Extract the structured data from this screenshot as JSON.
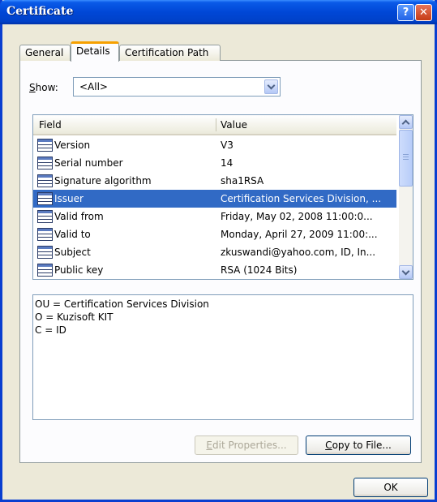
{
  "window": {
    "title": "Certificate",
    "help_label": "?",
    "close_label": "✕"
  },
  "tabs": [
    {
      "label": "General",
      "active": false
    },
    {
      "label": "Details",
      "active": true
    },
    {
      "label": "Certification Path",
      "active": false
    }
  ],
  "show": {
    "label_mnemonic": "S",
    "label_rest": "how:",
    "value": "<All>"
  },
  "list": {
    "headers": {
      "field": "Field",
      "value": "Value"
    },
    "rows": [
      {
        "field": "Version",
        "value": "V3"
      },
      {
        "field": "Serial number",
        "value": "14"
      },
      {
        "field": "Signature algorithm",
        "value": "sha1RSA"
      },
      {
        "field": "Issuer",
        "value": "Certification Services Division, ..."
      },
      {
        "field": "Valid from",
        "value": "Friday, May 02, 2008 11:00:0..."
      },
      {
        "field": "Valid to",
        "value": "Monday, April 27, 2009 11:00:..."
      },
      {
        "field": "Subject",
        "value": "zkuswandi@yahoo.com, ID, In..."
      },
      {
        "field": "Public key",
        "value": "RSA (1024 Bits)"
      }
    ],
    "selected_index": 3
  },
  "detail": {
    "lines": [
      "OU = Certification Services Division",
      "O = Kuzisoft KIT",
      "C = ID"
    ]
  },
  "buttons": {
    "edit_mnemonic": "E",
    "edit_rest": "dit Properties...",
    "copy_mnemonic": "C",
    "copy_rest": "opy to File...",
    "ok": "OK"
  },
  "icons": {
    "field_row": "certificate-field-icon"
  },
  "colors": {
    "selection": "#316ac5",
    "titlebar": "#0047d6",
    "tab_highlight": "#f6a000"
  }
}
